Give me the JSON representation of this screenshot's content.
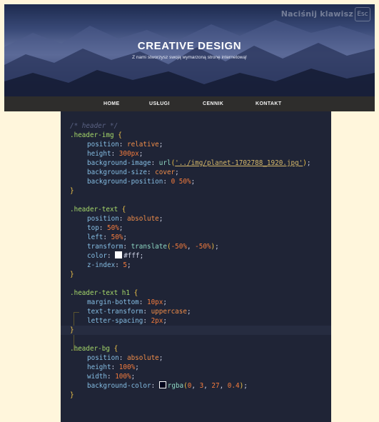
{
  "header": {
    "title": "CREATIVE DESIGN",
    "subtitle": "Z nami stworzysz swoją wymarzoną stronę internetową!",
    "hint_text": "Naciśnij klawisz",
    "hint_key": "Esc"
  },
  "nav": {
    "items": [
      "HOME",
      "USŁUGI",
      "CENNIK",
      "KONTAKT"
    ]
  },
  "code": {
    "comment": "/* header */",
    "b1": {
      "sel": ".header-img",
      "open": "{",
      "p1": "position",
      "v1": "relative",
      "p2": "height",
      "v2": "300px",
      "p3": "background-image",
      "v3_fn": "url",
      "v3_str": "'../img/planet-1702788_1920.jpg'",
      "p4": "background-size",
      "v4": "cover",
      "p5": "background-position",
      "v5": "0 50%",
      "close": "}"
    },
    "b2": {
      "sel": ".header-text",
      "open": "{",
      "p1": "position",
      "v1": "absolute",
      "p2": "top",
      "v2": "50%",
      "p3": "left",
      "v3": "50%",
      "p4": "transform",
      "v4_fn": "translate",
      "v4_a": "-50%",
      "v4_b": "-50%",
      "p5": "color",
      "v5": "#fff",
      "p6": "z-index",
      "v6": "5",
      "close": "}"
    },
    "b3": {
      "sel": ".header-text h1",
      "open": "{",
      "p1": "margin-bottom",
      "v1": "10px",
      "p2": "text-transform",
      "v2": "uppercase",
      "p3": "letter-spacing",
      "v3": "2px",
      "close": "}"
    },
    "b4": {
      "sel": ".header-bg",
      "open": "{",
      "p1": "position",
      "v1": "absolute",
      "p2": "height",
      "v2": "100%",
      "p3": "width",
      "v3": "100%",
      "p4": "background-color",
      "v4_fn": "rgba",
      "v4_args": [
        "0",
        "3",
        "27",
        "0.4"
      ],
      "close": "}"
    }
  },
  "colors": {
    "page_bg": "#fff6dc",
    "nav_bg": "#2e2d2c",
    "editor_bg": "#1f2436",
    "swatch_white": "#ffffff",
    "swatch_dark": "#00031b"
  }
}
